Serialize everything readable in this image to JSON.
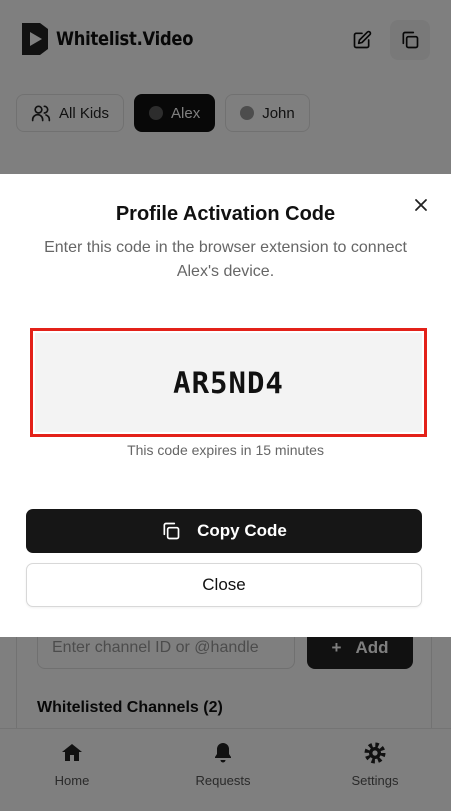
{
  "app": {
    "brand": "Whitelist.Video",
    "header": {
      "edit_icon": "edit-icon",
      "copy_icon": "copy-icon"
    },
    "kid_tabs": [
      {
        "label": "All Kids",
        "icon": "users-icon",
        "active": false
      },
      {
        "label": "Alex",
        "icon": "avatar-dot",
        "active": true
      },
      {
        "label": "John",
        "icon": "avatar-dot",
        "active": false
      }
    ],
    "channel_input": {
      "placeholder": "Enter channel ID or @handle"
    },
    "add_button": {
      "label": "Add",
      "icon": "plus-icon"
    },
    "whitelisted_title": "Whitelisted Channels (2)",
    "nav": [
      {
        "label": "Home",
        "icon": "home-icon"
      },
      {
        "label": "Requests",
        "icon": "bell-icon"
      },
      {
        "label": "Settings",
        "icon": "gear-icon"
      }
    ]
  },
  "modal": {
    "title": "Profile Activation Code",
    "description": "Enter this code in the browser extension to connect Alex's device.",
    "code": "AR5ND4",
    "expires": "This code expires in 15 minutes",
    "copy_button": "Copy Code",
    "close_button": "Close"
  },
  "colors": {
    "highlight": "#e32119",
    "primary": "#161616",
    "overlay": "rgba(0,0,0,0.5)"
  }
}
